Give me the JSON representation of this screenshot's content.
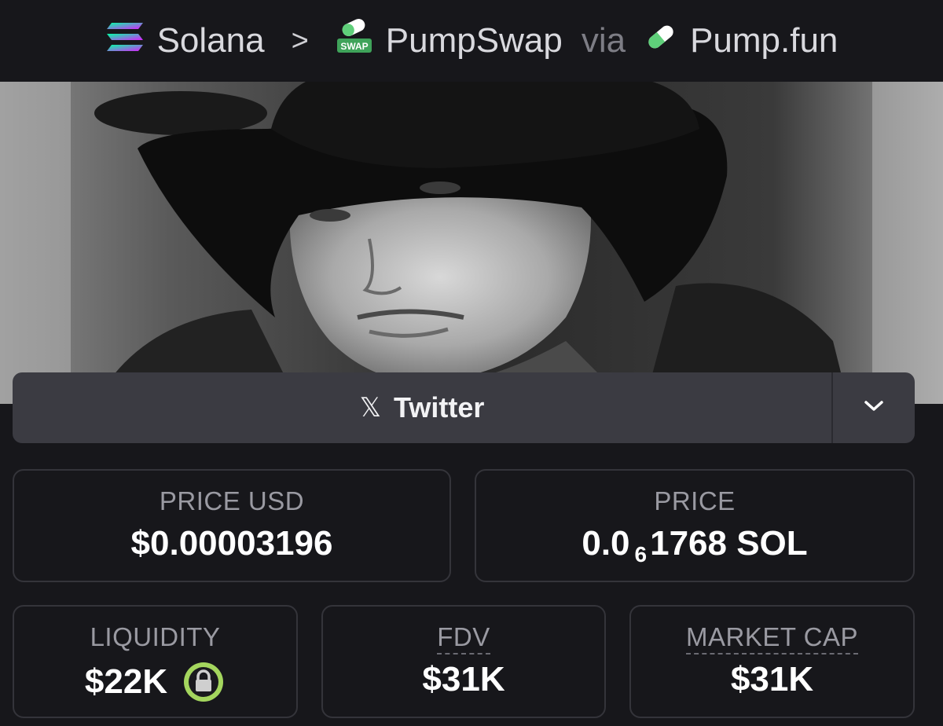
{
  "breadcrumb": {
    "chain": "Solana",
    "separator": ">",
    "dex": "PumpSwap",
    "dex_badge": "SWAP",
    "via": "via",
    "launchpad": "Pump.fun"
  },
  "hero": {
    "icon": "token-banner-image"
  },
  "social": {
    "label": "Twitter",
    "icon": "x-logo-icon",
    "toggle_icon": "chevron-down-icon"
  },
  "stats": {
    "price_usd": {
      "label": "PRICE USD",
      "value": "$0.00003196"
    },
    "price": {
      "label": "PRICE",
      "prefix": "0.0",
      "zeros": "6",
      "suffix": "1768 SOL"
    },
    "liquidity": {
      "label": "LIQUIDITY",
      "value": "$22K",
      "icon": "lock-icon"
    },
    "fdv": {
      "label": "FDV",
      "value": "$31K"
    },
    "market_cap": {
      "label": "MARKET CAP",
      "value": "$31K"
    }
  },
  "colors": {
    "background": "#17171b",
    "panel": "#3b3b42",
    "card_border": "#34343a",
    "label": "#9a9aa2",
    "lock_green": "#a4d65e"
  }
}
